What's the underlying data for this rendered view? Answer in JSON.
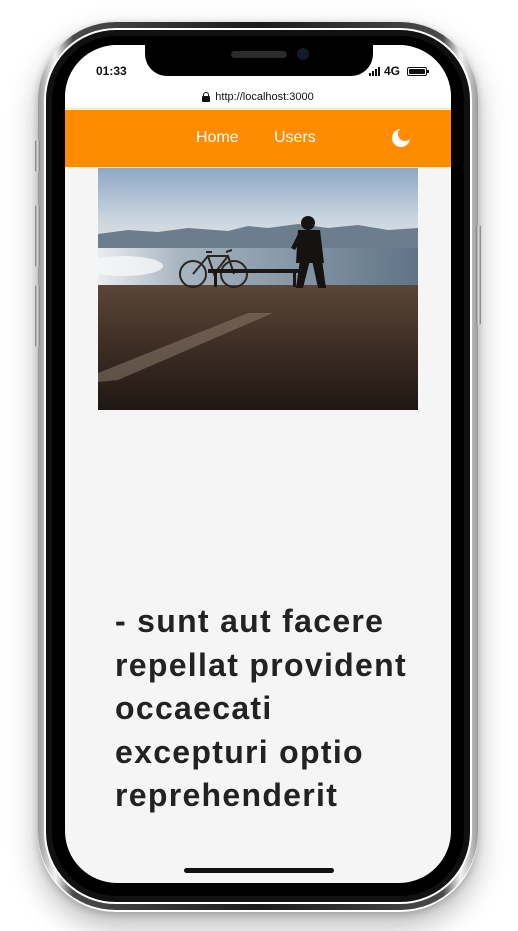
{
  "status_bar": {
    "time": "01:33",
    "network": "4G"
  },
  "browser": {
    "url": "http://localhost:3000",
    "lock_icon": "lock-icon"
  },
  "navbar": {
    "background_color": "#ff8c00",
    "links": [
      {
        "label": "Home"
      },
      {
        "label": "Users"
      }
    ],
    "theme_toggle_icon": "moon-icon"
  },
  "hero_image": {
    "subject": "photo"
  },
  "post": {
    "title": "- sunt aut facere repellat provident occaecati excepturi optio reprehenderit"
  }
}
